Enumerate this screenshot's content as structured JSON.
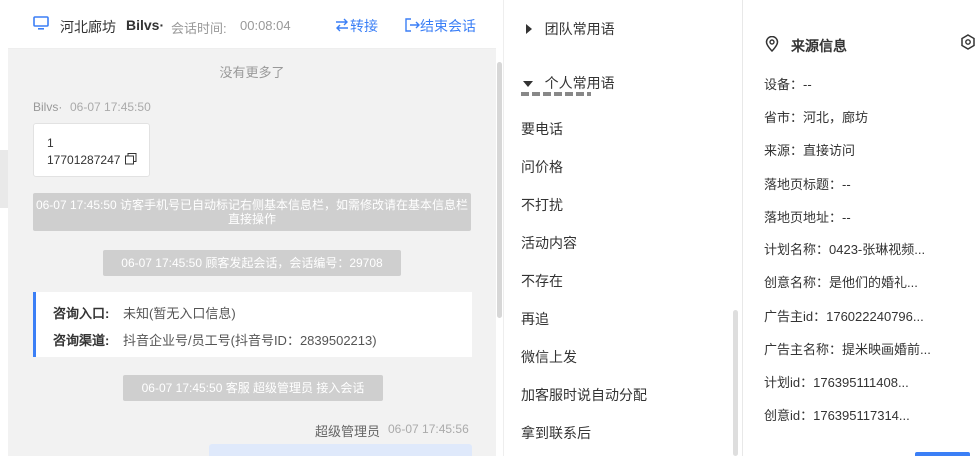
{
  "header": {
    "location": "河北廊坊",
    "visitor": "Bilvs·",
    "session_time_label": "会话时间:",
    "session_time": "00:08:04",
    "transfer_label": "转接",
    "end_label": "结束会话"
  },
  "chat": {
    "no_more": "没有更多了",
    "visitor_name": "Bilvs·",
    "visitor_time": "06-07 17:45:50",
    "bubble_line1": "1",
    "bubble_line2": "17701287247",
    "sys1": "06-07 17:45:50 访客手机号已自动标记右侧基本信息栏，如需修改请在基本信息栏直接操作",
    "sys2": "06-07 17:45:50 顾客发起会话，会话编号：29708",
    "entry_label": "咨询入口:",
    "entry_value": "未知(暂无入口信息)",
    "channel_label": "咨询渠道:",
    "channel_value": "抖音企业号/员工号(抖音号ID：2839502213)",
    "sys3": "06-07 17:45:50 客服 超级管理员 接入会话",
    "agent_name": "超级管理员",
    "agent_time": "06-07 17:45:56"
  },
  "phrases": {
    "team_title": "团队常用语",
    "personal_title": "个人常用语",
    "items": [
      "要电话",
      "问价格",
      "不打扰",
      "活动内容",
      "不存在",
      "再追",
      "微信上发",
      "加客服时说自动分配",
      "拿到联系后"
    ]
  },
  "source": {
    "title": "来源信息",
    "rows": [
      "设备：--",
      "省市：河北，廊坊",
      "来源：直接访问",
      "落地页标题：--",
      "落地页地址：--",
      "计划名称：0423-张琳视频...",
      "创意名称：是他们的婚礼...",
      "广告主id：176022240796...",
      "广告主名称：提米映画婚前...",
      "计划id：176395111408...",
      "创意id：176395117314..."
    ]
  },
  "colors": {
    "accent": "#3b7ff6",
    "system_bubble": "#cfcfcf"
  }
}
